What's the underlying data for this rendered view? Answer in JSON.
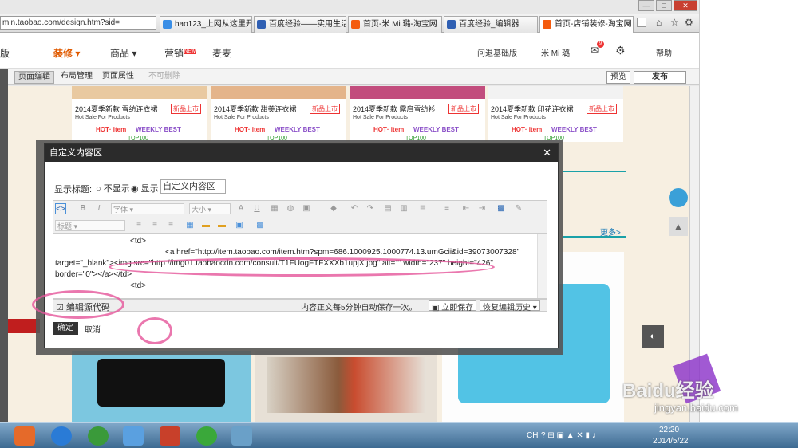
{
  "browser": {
    "url": "min.taobao.com/design.htm?sid=",
    "tabs": [
      {
        "label": "hao123_上网从这里开始"
      },
      {
        "label": "百度经验——实用生活..."
      },
      {
        "label": "首页-米 Mi 璐-淘宝网"
      },
      {
        "label": "百度经验_编辑器"
      },
      {
        "label": "首页-店铺装修-淘宝网"
      }
    ]
  },
  "topnav": {
    "left_cut": "版",
    "decorate": "装修",
    "goods": "商品",
    "marketing": "营销",
    "marketing_badge": "NEW",
    "maimai": "麦麦",
    "back_basic": "问退基础版",
    "user": "米 Mi 璐",
    "msg_count": "9",
    "help": "帮助"
  },
  "toolbar": {
    "page_edit": "页面编辑",
    "layout": "布局管理",
    "page_attr": "页面属性",
    "no_delete": "不可删除",
    "preview": "预览",
    "publish": "发布"
  },
  "products": [
    {
      "title": "2014夏季新款 雪纺连衣裙",
      "sub": "Hot Sale For Products",
      "hot": "HOT· item",
      "best": "WEEKLY BEST",
      "top": "TOP100",
      "new": "新品上市"
    },
    {
      "title": "2014夏季新款 甜美连衣裙",
      "sub": "Hot Sale For Products",
      "hot": "HOT· item",
      "best": "WEEKLY BEST",
      "top": "TOP100",
      "new": "新品上市"
    },
    {
      "title": "2014夏季新款 露肩雪纺衫",
      "sub": "Hot Sale For Products",
      "hot": "HOT· item",
      "best": "WEEKLY BEST",
      "top": "TOP100",
      "new": "新品上市"
    },
    {
      "title": "2014夏季新款 印花连衣裙",
      "sub": "Hot Sale For Products",
      "hot": "HOT· item",
      "best": "WEEKLY BEST",
      "top": "TOP100",
      "new": "新品上市"
    }
  ],
  "more": "更多>",
  "modal": {
    "title": "自定义内容区",
    "show_title_label": "显示标题:",
    "hide_option": "不显示",
    "show_option": "显示",
    "title_value": "自定义内容区",
    "font_select": "字体",
    "size_select": "大小",
    "heading_select": "标题",
    "code_lines": [
      "<td>",
      "<a href=\"http://item.taobao.com/item.htm?spm=686.1000925.1000774.13.umGcii&id=39073007328\"",
      "target=\"_blank\"><img src=\"http://img01.taobaocdn.com/consult/T1FUogFTFXXXb1upjX.jpg\" alt=\"\" width=\"237\" height=\"426\"",
      "border=\"0\"></a></td>",
      "<td>"
    ],
    "edit_source": "编辑源代码",
    "autosave_note": "内容正文每5分钟自动保存一次。",
    "save_now": "立即保存",
    "restore_history": "恢复编辑历史",
    "confirm": "确定",
    "cancel": "取消"
  },
  "taskbar": {
    "lang": "CH",
    "time": "22:20",
    "date": "2014/5/22"
  },
  "watermark": "Baidu经验",
  "watermark_url": "jingyan.baidu.com"
}
